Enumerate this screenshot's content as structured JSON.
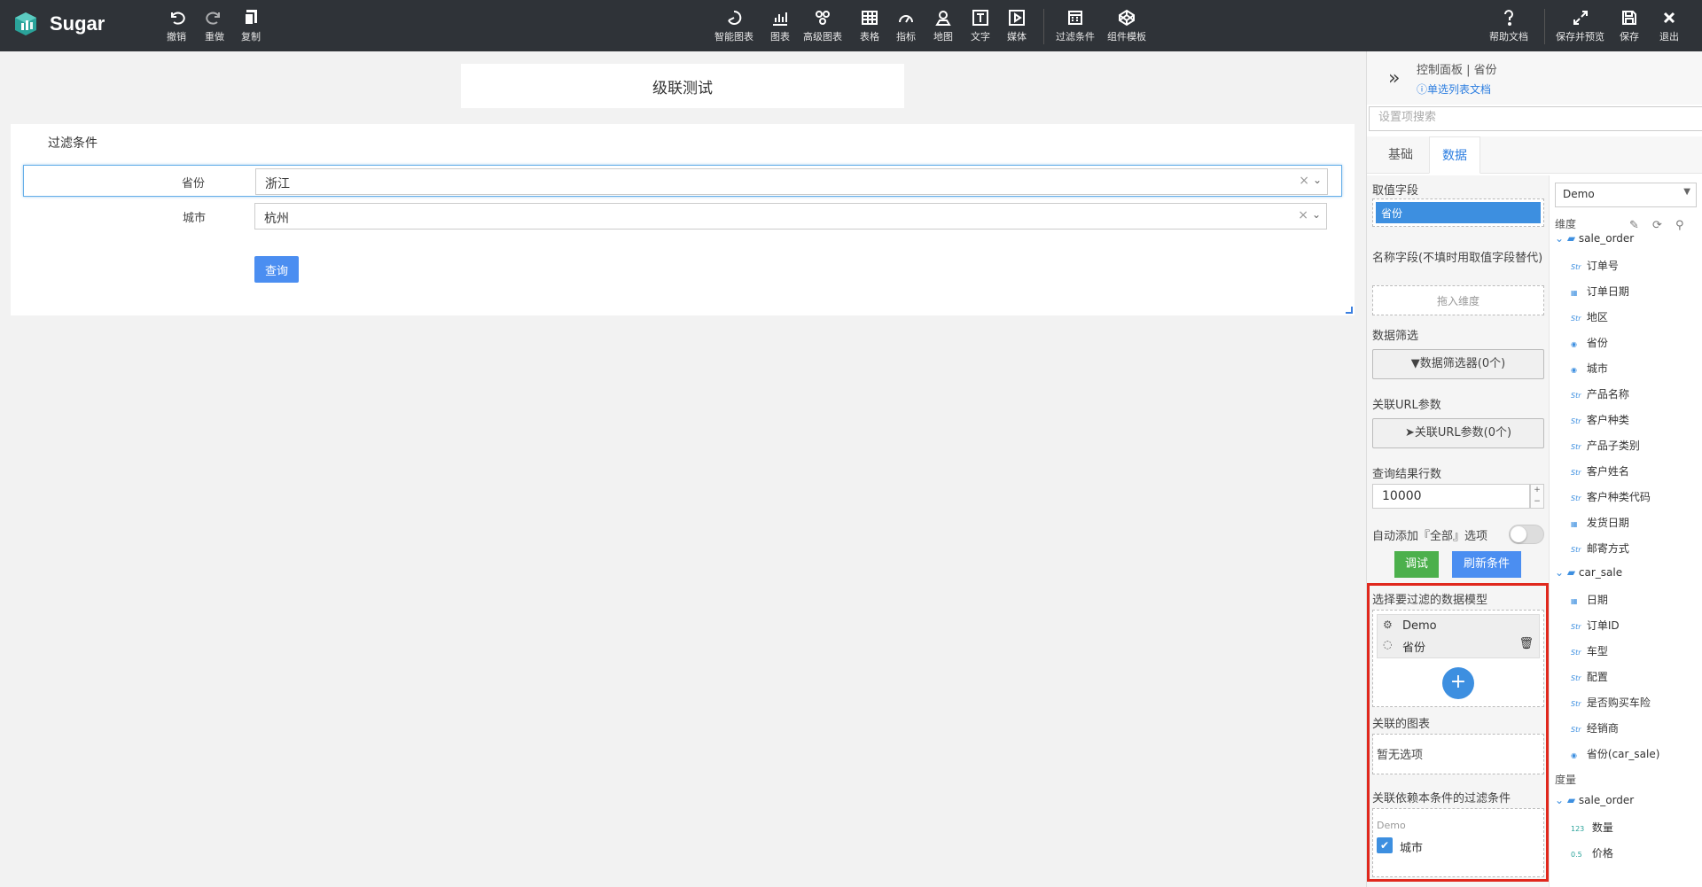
{
  "app": {
    "name": "Sugar"
  },
  "toolbar": {
    "undo": "撤销",
    "redo": "重做",
    "copy": "复制",
    "smart_chart": "智能图表",
    "chart": "图表",
    "advanced_chart": "高级图表",
    "table": "表格",
    "metric": "指标",
    "map": "地图",
    "text": "文字",
    "media": "媒体",
    "filter": "过滤条件",
    "template": "组件模板",
    "help": "帮助文档",
    "save_preview": "保存并预览",
    "save": "保存",
    "exit": "退出"
  },
  "canvas": {
    "title": "级联测试",
    "filter_panel": {
      "title": "过滤条件",
      "rows": [
        {
          "label": "省份",
          "value": "浙江",
          "clear": "×",
          "caret": "⌄"
        },
        {
          "label": "城市",
          "value": "杭州",
          "clear": "×",
          "caret": "⌄"
        }
      ],
      "query_button": "查询"
    }
  },
  "panel": {
    "title": "控制面板 | 省份",
    "doc_link": "单选列表文档",
    "search_placeholder": "设置项搜索",
    "tabs": [
      "基础",
      "数据"
    ],
    "value_field": {
      "label": "取值字段",
      "chip": "省份"
    },
    "name_field": {
      "label": "名称字段(不填时用取值字段替代)",
      "placeholder": "拖入维度"
    },
    "data_filter": {
      "label": "数据筛选",
      "button": "数据筛选器(0个)"
    },
    "url_param": {
      "label": "关联URL参数",
      "button": "关联URL参数(0个)"
    },
    "row_limit": {
      "label": "查询结果行数",
      "value": "10000"
    },
    "auto_all": {
      "label": "自动添加『全部』选项"
    },
    "debug_button": "调试",
    "refresh_button": "刷新条件",
    "filter_model": {
      "label": "选择要过滤的数据模型",
      "model": "Demo",
      "field": "省份",
      "add": "+"
    },
    "linked_charts": {
      "label": "关联的图表",
      "empty": "暂无选项"
    },
    "dependent_filters": {
      "label": "关联依赖本条件的过滤条件",
      "group": "Demo",
      "item": "城市"
    }
  },
  "fields": {
    "datasource": "Demo",
    "dimension_label": "维度",
    "measure_label": "度量",
    "groups": [
      {
        "name": "sale_order",
        "items": [
          {
            "type": "Str",
            "name": "订单号"
          },
          {
            "type": "date",
            "name": "订单日期"
          },
          {
            "type": "Str",
            "name": "地区"
          },
          {
            "type": "geo",
            "name": "省份"
          },
          {
            "type": "geo",
            "name": "城市"
          },
          {
            "type": "Str",
            "name": "产品名称"
          },
          {
            "type": "Str",
            "name": "客户种类"
          },
          {
            "type": "Str",
            "name": "产品子类别"
          },
          {
            "type": "Str",
            "name": "客户姓名"
          },
          {
            "type": "Str",
            "name": "客户种类代码"
          },
          {
            "type": "date",
            "name": "发货日期"
          },
          {
            "type": "Str",
            "name": "邮寄方式"
          }
        ]
      },
      {
        "name": "car_sale",
        "items": [
          {
            "type": "date",
            "name": "日期"
          },
          {
            "type": "Str",
            "name": "订单ID"
          },
          {
            "type": "Str",
            "name": "车型"
          },
          {
            "type": "Str",
            "name": "配置"
          },
          {
            "type": "Str",
            "name": "是否购买车险"
          },
          {
            "type": "Str",
            "name": "经销商"
          },
          {
            "type": "geo",
            "name": "省份(car_sale)"
          }
        ]
      }
    ],
    "measure_groups": [
      {
        "name": "sale_order",
        "items": [
          {
            "type": "123",
            "name": "数量"
          },
          {
            "type": "0.5",
            "name": "价格"
          }
        ]
      }
    ]
  }
}
